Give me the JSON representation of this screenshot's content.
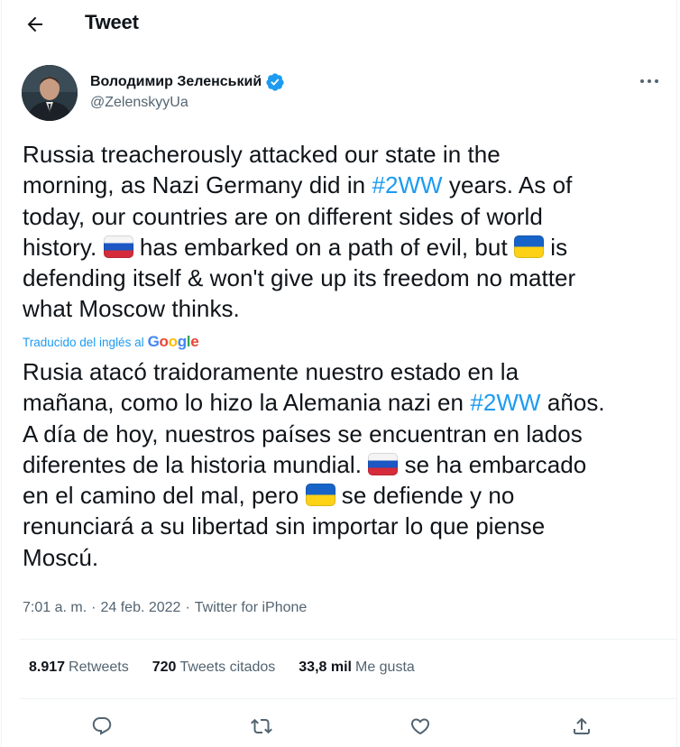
{
  "header": {
    "title": "Tweet"
  },
  "author": {
    "name": "Володимир Зеленський",
    "handle": "@ZelenskyyUa"
  },
  "tweet_en": {
    "part1": "Russia treacherously attacked our state in the\nmorning, as Nazi Germany did in ",
    "hashtag": "#2WW",
    "part2": " years. As of\ntoday, our countries are on different sides of world\nhistory. ",
    "part3": " has embarked on a path of evil, but ",
    "part4": " is\ndefending itself & won't give up its freedom no matter\nwhat Moscow thinks."
  },
  "translation": {
    "label": "Traducido del inglés al",
    "provider": "Google"
  },
  "tweet_es": {
    "part1": "Rusia atacó traidoramente nuestro estado en la\nmañana, como lo hizo la Alemania nazi en ",
    "hashtag": "#2WW",
    "part2": " años.\nA día de hoy, nuestros países se encuentran en lados\ndiferentes de la historia mundial. ",
    "part3": " se ha embarcado\nen el camino del mal, pero ",
    "part4": " se defiende y no\nrenunciará a su libertad sin importar lo que piense\nMoscú."
  },
  "meta": {
    "time": "7:01 a. m.",
    "sep1": "·",
    "date": "24 feb. 2022",
    "sep2": "·",
    "source": "Twitter for iPhone"
  },
  "stats": {
    "retweets": {
      "value": "8.917",
      "label": "Retweets"
    },
    "quotes": {
      "value": "720",
      "label": "Tweets citados"
    },
    "likes": {
      "value": "33,8 mil",
      "label": "Me gusta"
    }
  },
  "colors": {
    "accent": "#1d9bf0",
    "muted": "#536471",
    "text": "#0f1419",
    "divider": "#eff3f4"
  },
  "icons": {
    "back": "arrow-left-icon",
    "verified": "verified-badge-icon",
    "more": "more-horizontal-icon",
    "reply": "reply-icon",
    "retweet": "retweet-icon",
    "like": "heart-icon",
    "share": "share-icon",
    "flag_russia": "russia-flag-icon",
    "flag_ukraine": "ukraine-flag-icon"
  }
}
